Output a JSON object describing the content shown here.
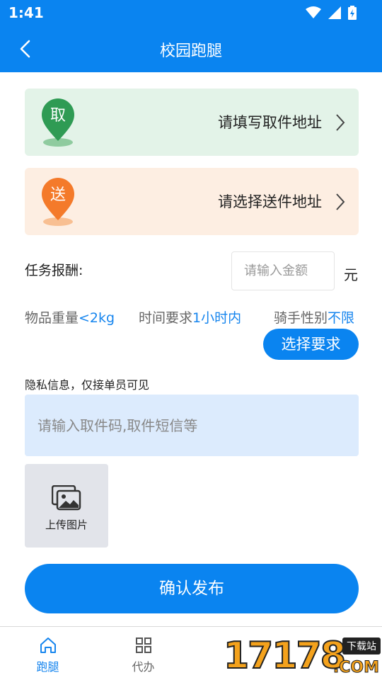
{
  "status_bar": {
    "time": "1:41"
  },
  "header": {
    "title": "校园跑腿"
  },
  "pickup": {
    "badge": "取",
    "text": "请填写取件地址",
    "color": "#2f9b54"
  },
  "delivery": {
    "badge": "送",
    "text": "请选择送件地址",
    "color": "#f47a2a"
  },
  "reward": {
    "label": "任务报酬:",
    "placeholder": "请输入金额",
    "unit": "元"
  },
  "requirements": {
    "weight_label": "物品重量",
    "weight_value": "<2kg",
    "time_label": "时间要求",
    "time_value": "1小时内",
    "gender_label": "骑手性别",
    "gender_value": "不限",
    "select_button": "选择要求"
  },
  "privacy": {
    "label": "隐私信息，仅接单员可见",
    "placeholder": "请输入取件码,取件短信等"
  },
  "upload": {
    "label": "上传图片"
  },
  "confirm": {
    "label": "确认发布"
  },
  "tabs": [
    {
      "label": "跑腿",
      "icon": "home-icon",
      "active": true
    },
    {
      "label": "代办",
      "icon": "grid-icon",
      "active": false
    }
  ],
  "watermark": {
    "number": "17178",
    "tag": "下载站",
    "domain": ".COM"
  },
  "colors": {
    "primary": "#0a84f0",
    "accent_text": "#1685ee"
  }
}
